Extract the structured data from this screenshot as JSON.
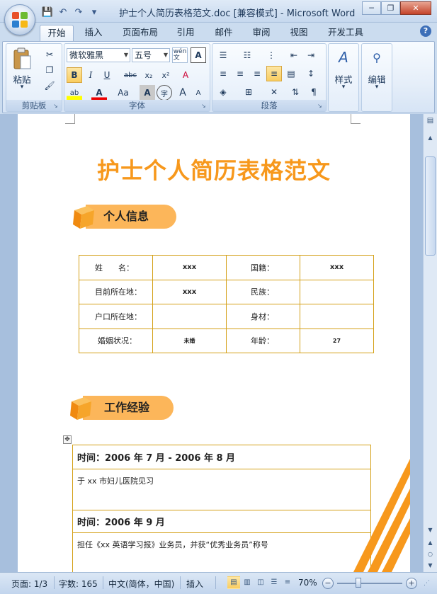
{
  "window": {
    "title": "护士个人简历表格范文.doc [兼容模式] - Microsoft Word",
    "minimize": "─",
    "restore": "❐",
    "close": "✕"
  },
  "quick_access": {
    "save": "💾",
    "undo": "↶",
    "redo": "↷",
    "more": "▾"
  },
  "tabs": [
    "开始",
    "插入",
    "页面布局",
    "引用",
    "邮件",
    "审阅",
    "视图",
    "开发工具"
  ],
  "active_tab": "开始",
  "ribbon": {
    "clipboard": {
      "label": "剪贴板",
      "paste": "粘贴",
      "paste_arrow": "▾"
    },
    "font": {
      "label": "字体",
      "font_name": "微软雅黑",
      "font_size": "五号",
      "phonetic": "wén\n文",
      "bold": "B",
      "italic": "I",
      "underline": "U",
      "strike": "abc",
      "subscript": "x₂",
      "superscript": "x²",
      "clear": "A",
      "highlight": "ab",
      "font_color": "A",
      "change_case": "Aa",
      "char_shading": "A",
      "enclose": "字",
      "grow": "A",
      "shrink": "A"
    },
    "paragraph": {
      "label": "段落"
    },
    "styles": {
      "label": "样式"
    },
    "editing": {
      "label": "编辑"
    }
  },
  "document": {
    "title": "护士个人简历表格范文",
    "section1": "个人信息",
    "section2": "工作经验",
    "info_table": [
      [
        "姓　　名：",
        "xxx",
        "国籍：",
        "xxx"
      ],
      [
        "目前所在地：",
        "xxx",
        "民族：",
        ""
      ],
      [
        "户口所在地：",
        "",
        "身材：",
        ""
      ],
      [
        "婚姻状况：",
        "未婚",
        "年龄：",
        "27"
      ]
    ],
    "work": [
      {
        "time": "时间：2006 年 7 月 - 2006 年 8 月",
        "desc": "于 xx 市妇儿医院见习"
      },
      {
        "time": "时间：2006 年 9 月",
        "desc": "担任《xx 英语学习报》业务员，并获“优秀业务员”称号"
      }
    ]
  },
  "status": {
    "page": "页面: 1/3",
    "words": "字数: 165",
    "language": "中文(简体，中国)",
    "mode": "插入",
    "zoom": "70%"
  },
  "colors": {
    "accent": "#f7981c",
    "pill": "#fcb65a",
    "table_border": "#d4a017"
  }
}
